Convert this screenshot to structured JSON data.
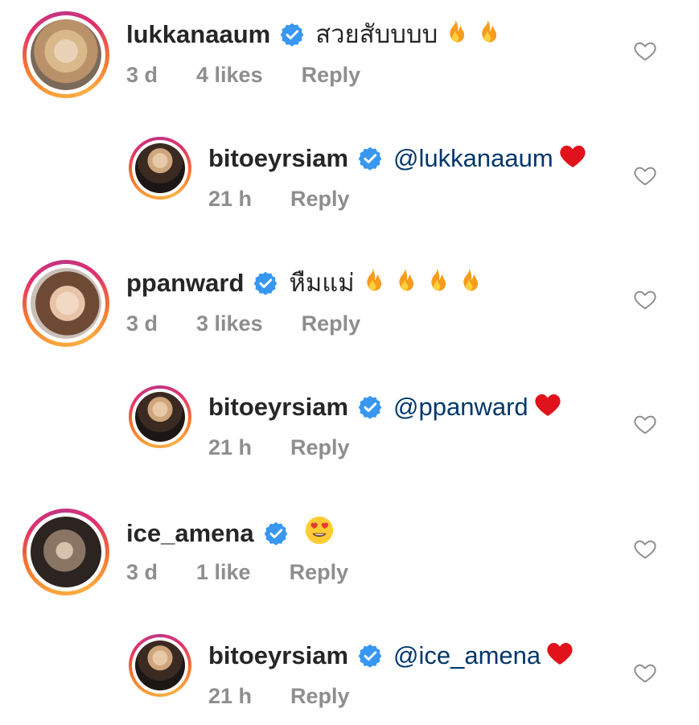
{
  "comments": [
    {
      "username": "lukkanaaum",
      "text": "สวยสับบบบ",
      "emoji": [
        "fire",
        "fire"
      ],
      "time": "3 d",
      "likes": "4 likes",
      "reply": "Reply",
      "is_reply": false
    },
    {
      "username": "bitoeyrsiam",
      "mention": "@lukkanaaum",
      "emoji": [
        "heart"
      ],
      "time": "21 h",
      "reply": "Reply",
      "is_reply": true
    },
    {
      "username": "ppanward",
      "text": "หืมแม่",
      "emoji": [
        "fire",
        "fire",
        "fire",
        "fire"
      ],
      "time": "3 d",
      "likes": "3 likes",
      "reply": "Reply",
      "is_reply": false
    },
    {
      "username": "bitoeyrsiam",
      "mention": "@ppanward",
      "emoji": [
        "heart"
      ],
      "time": "21 h",
      "reply": "Reply",
      "is_reply": true
    },
    {
      "username": "ice_amena",
      "emoji": [
        "heart-eyes-face"
      ],
      "time": "3 d",
      "likes": "1 like",
      "reply": "Reply",
      "is_reply": false
    },
    {
      "username": "bitoeyrsiam",
      "mention": "@ice_amena",
      "emoji": [
        "heart"
      ],
      "time": "21 h",
      "reply": "Reply",
      "is_reply": true
    }
  ],
  "colors": {
    "verified": "#3897f0",
    "mention": "#00376b",
    "meta": "#8e8e8e",
    "heart": "#e0121b"
  }
}
